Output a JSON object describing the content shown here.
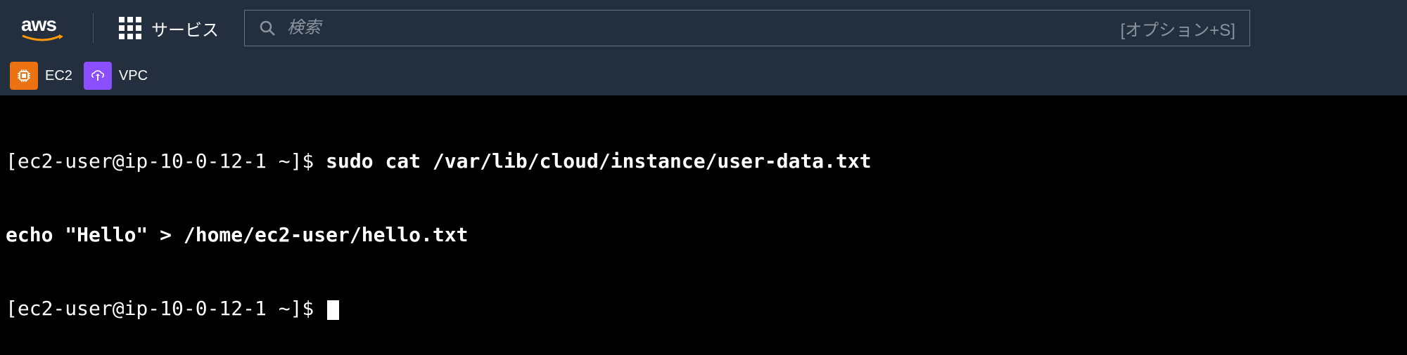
{
  "header": {
    "logo_text": "aws",
    "services_label": "サービス",
    "search_placeholder": "検索",
    "search_hint": "[オプション+S]"
  },
  "service_bar": {
    "items": [
      {
        "name": "ec2",
        "label": "EC2"
      },
      {
        "name": "vpc",
        "label": "VPC"
      }
    ]
  },
  "terminal": {
    "lines": [
      {
        "prompt": "[ec2-user@ip-10-0-12-1 ~]$ ",
        "command": "sudo cat /var/lib/cloud/instance/user-data.txt"
      },
      {
        "output": "echo \"Hello\" > /home/ec2-user/hello.txt"
      },
      {
        "prompt": "[ec2-user@ip-10-0-12-1 ~]$ ",
        "cursor": true
      }
    ]
  }
}
